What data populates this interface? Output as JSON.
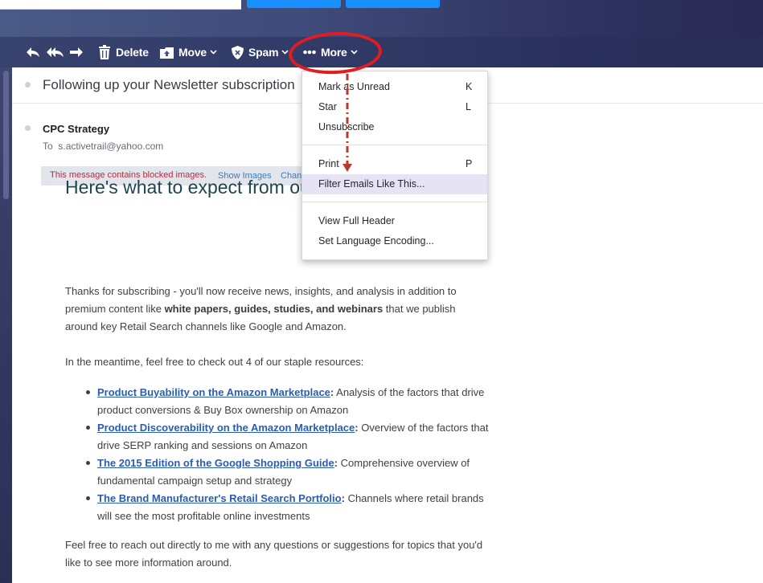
{
  "toolbar": {
    "delete_label": "Delete",
    "move_label": "Move",
    "spam_label": "Spam",
    "more_label": "More",
    "chevron": "⌄"
  },
  "message": {
    "subject": "Following up your Newsletter subscription",
    "sender": "CPC Strategy",
    "to_prefix": "To",
    "to_address": "s.activetrail@yahoo.com",
    "blocked_text": "This message contains blocked images.",
    "show_images": "Show Images",
    "change_link": "Chan"
  },
  "menu": {
    "items": [
      {
        "label": "Mark as Unread",
        "shortcut": "K"
      },
      {
        "label": "Star",
        "shortcut": "L"
      },
      {
        "label": "Unsubscribe",
        "shortcut": ""
      },
      {
        "label": "Print",
        "shortcut": "P"
      },
      {
        "label": "Filter Emails Like This...",
        "shortcut": ""
      },
      {
        "label": "View Full Header",
        "shortcut": ""
      },
      {
        "label": "Set Language Encoding...",
        "shortcut": ""
      }
    ]
  },
  "body": {
    "heading": "Here's what to expect from our Newsletter...",
    "intro_1": "Thanks for subscribing - you'll now receive news, insights, and analysis in addition to premium content like ",
    "intro_bold": "white papers, guides, studies, and webinars",
    "intro_2": " that we publish around key Retail Search channels like Google and Amazon.",
    "meantime": "In the meantime, feel free to check out 4 of our staple resources:",
    "resources": [
      {
        "link": "Product Buyability on the Amazon Marketplace",
        "desc": " Analysis of the factors that drive product conversions & Buy Box ownership on Amazon"
      },
      {
        "link": "Product Discoverability on the Amazon Marketplace",
        "desc": " Overview of the factors that drive SERP ranking and sessions on Amazon"
      },
      {
        "link": "The 2015 Edition of the Google Shopping Guide",
        "desc": " Comprehensive overview of fundamental campaign setup and strategy"
      },
      {
        "link": "The Brand Manufacturer's Retail Search Portfolio",
        "desc": " Channels where retail brands will see the most profitable online investments"
      }
    ],
    "closing": "Feel free to reach out directly to me with any questions or suggestions for topics that you'd like to see more information around."
  },
  "colors": {
    "accent_blue": "#188fff",
    "annotation_red": "#e11c22",
    "link_blue": "#2a5db0",
    "blocked_red": "#c0283a"
  },
  "icons": [
    "reply-icon",
    "reply-all-icon",
    "forward-icon",
    "trash-icon",
    "move-icon",
    "spam-shield-icon",
    "more-dots-icon"
  ]
}
